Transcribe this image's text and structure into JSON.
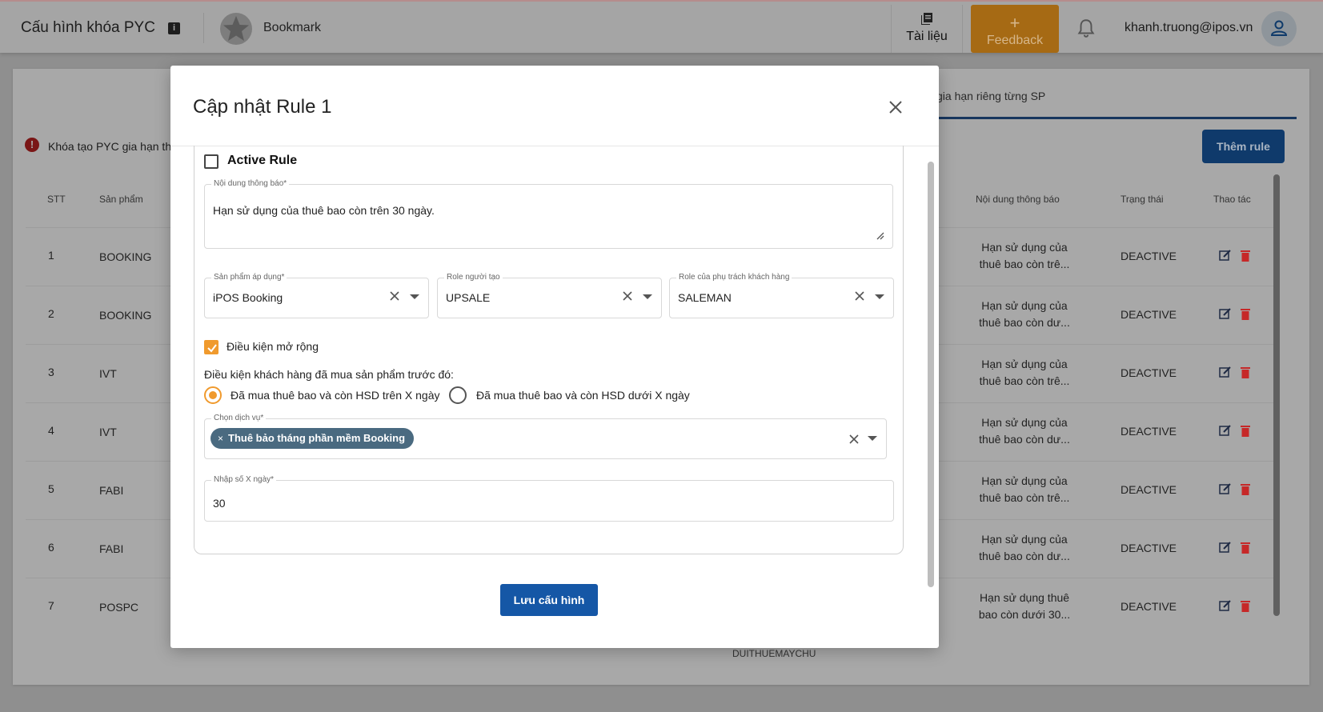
{
  "topbar": {
    "title": "Cấu hình khóa PYC",
    "info_icon": "info-icon",
    "bookmark_label": "Bookmark",
    "docs_label": "Tài liệu",
    "feedback_label": "Feedback",
    "feedback_plus": "+",
    "user_email": "khanh.truong@ipos.vn"
  },
  "background": {
    "tab_label": "gia hạn riêng từng SP",
    "warning_text": "Khóa tạo PYC gia hạn th",
    "add_rule_label": "Thêm rule",
    "columns": {
      "stt": "STT",
      "product": "Sản phẩm",
      "message": "Nội dung thông báo",
      "status": "Trạng thái",
      "actions": "Thao tác"
    },
    "rows": [
      {
        "stt": "1",
        "product": "BOOKING",
        "msg1": "Hạn sử dụng của",
        "msg2": "thuê bao còn trê...",
        "status": "DEACTIVE"
      },
      {
        "stt": "2",
        "product": "BOOKING",
        "msg1": "Hạn sử dụng của",
        "msg2": "thuê bao còn dư...",
        "status": "DEACTIVE"
      },
      {
        "stt": "3",
        "product": "IVT",
        "msg1": "Hạn sử dụng của",
        "msg2": "thuê bao còn trê...",
        "status": "DEACTIVE"
      },
      {
        "stt": "4",
        "product": "IVT",
        "msg1": "Hạn sử dụng của",
        "msg2": "thuê bao còn dư...",
        "status": "DEACTIVE"
      },
      {
        "stt": "5",
        "product": "FABI",
        "msg1": "Hạn sử dụng của",
        "msg2": "thuê bao còn trê...",
        "status": "DEACTIVE"
      },
      {
        "stt": "6",
        "product": "FABI",
        "msg1": "Hạn sử dụng của",
        "msg2": "thuê bao còn dư...",
        "status": "DEACTIVE"
      },
      {
        "stt": "7",
        "product": "POSPC",
        "msg1": "Hạn sử dụng thuê",
        "msg2": "bao còn dưới 30...",
        "status": "DEACTIVE"
      }
    ],
    "truncated_cell": "DUITHUEMAYCHU"
  },
  "modal": {
    "title": "Cập nhật Rule 1",
    "active_rule_label": "Active Rule",
    "active_rule_checked": false,
    "message_field": {
      "label": "Nội dung thông báo*",
      "value": "Hạn sử dụng của thuê bao còn trên 30 ngày."
    },
    "product_field": {
      "label": "Sản phẩm áp dụng*",
      "value": "iPOS Booking"
    },
    "creator_role_field": {
      "label": "Role người tạo",
      "value": "UPSALE"
    },
    "owner_role_field": {
      "label": "Role của phụ trách khách hàng",
      "value": "SALEMAN"
    },
    "extended_condition_label": "Điều kiện mở rộng",
    "extended_condition_checked": true,
    "condition_question": "Điều kiện khách hàng đã mua sản phẩm trước đó:",
    "radio_options": [
      {
        "label": "Đã mua thuê bao và còn HSD trên X ngày",
        "selected": true
      },
      {
        "label": "Đã mua thuê bao và còn HSD dưới X ngày",
        "selected": false
      }
    ],
    "service_field": {
      "label": "Chọn dịch vụ*",
      "chip": "Thuê bảo tháng phần mềm Booking"
    },
    "days_field": {
      "label": "Nhập số X ngày*",
      "value": "30"
    },
    "save_label": "Lưu cấu hình"
  },
  "colors": {
    "accent_orange": "#f09a2d",
    "primary_blue": "#1557a6",
    "delete_red": "#c62828",
    "chip_bg": "#4a6a80"
  }
}
